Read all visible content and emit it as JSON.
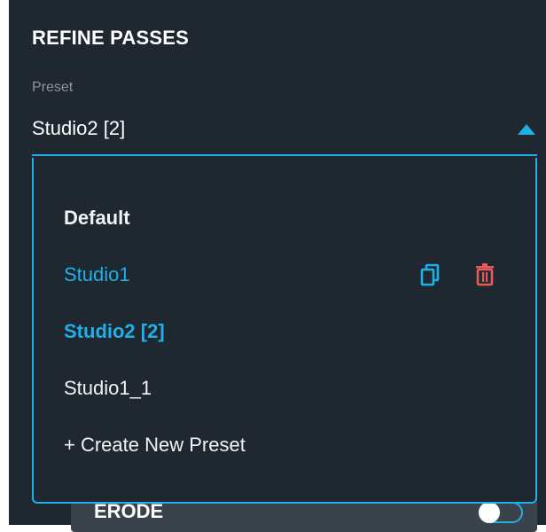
{
  "panel": {
    "title": "REFINE PASSES",
    "preset_label": "Preset",
    "selected_preset": "Studio2 [2]"
  },
  "dropdown": {
    "options": [
      {
        "label": "Default"
      },
      {
        "label": "Studio1",
        "actions": [
          "copy-icon",
          "trash-icon"
        ]
      },
      {
        "label": "Studio2 [2]"
      },
      {
        "label": "Studio1_1"
      },
      {
        "label": "+ Create New Preset"
      }
    ]
  },
  "erode": {
    "label": "ERODE",
    "enabled": false
  },
  "colors": {
    "panel_bg": "#1f2730",
    "accent": "#1fb0e8",
    "danger": "#e85a5a",
    "text": "#ffffff",
    "muted": "#8d949c"
  }
}
